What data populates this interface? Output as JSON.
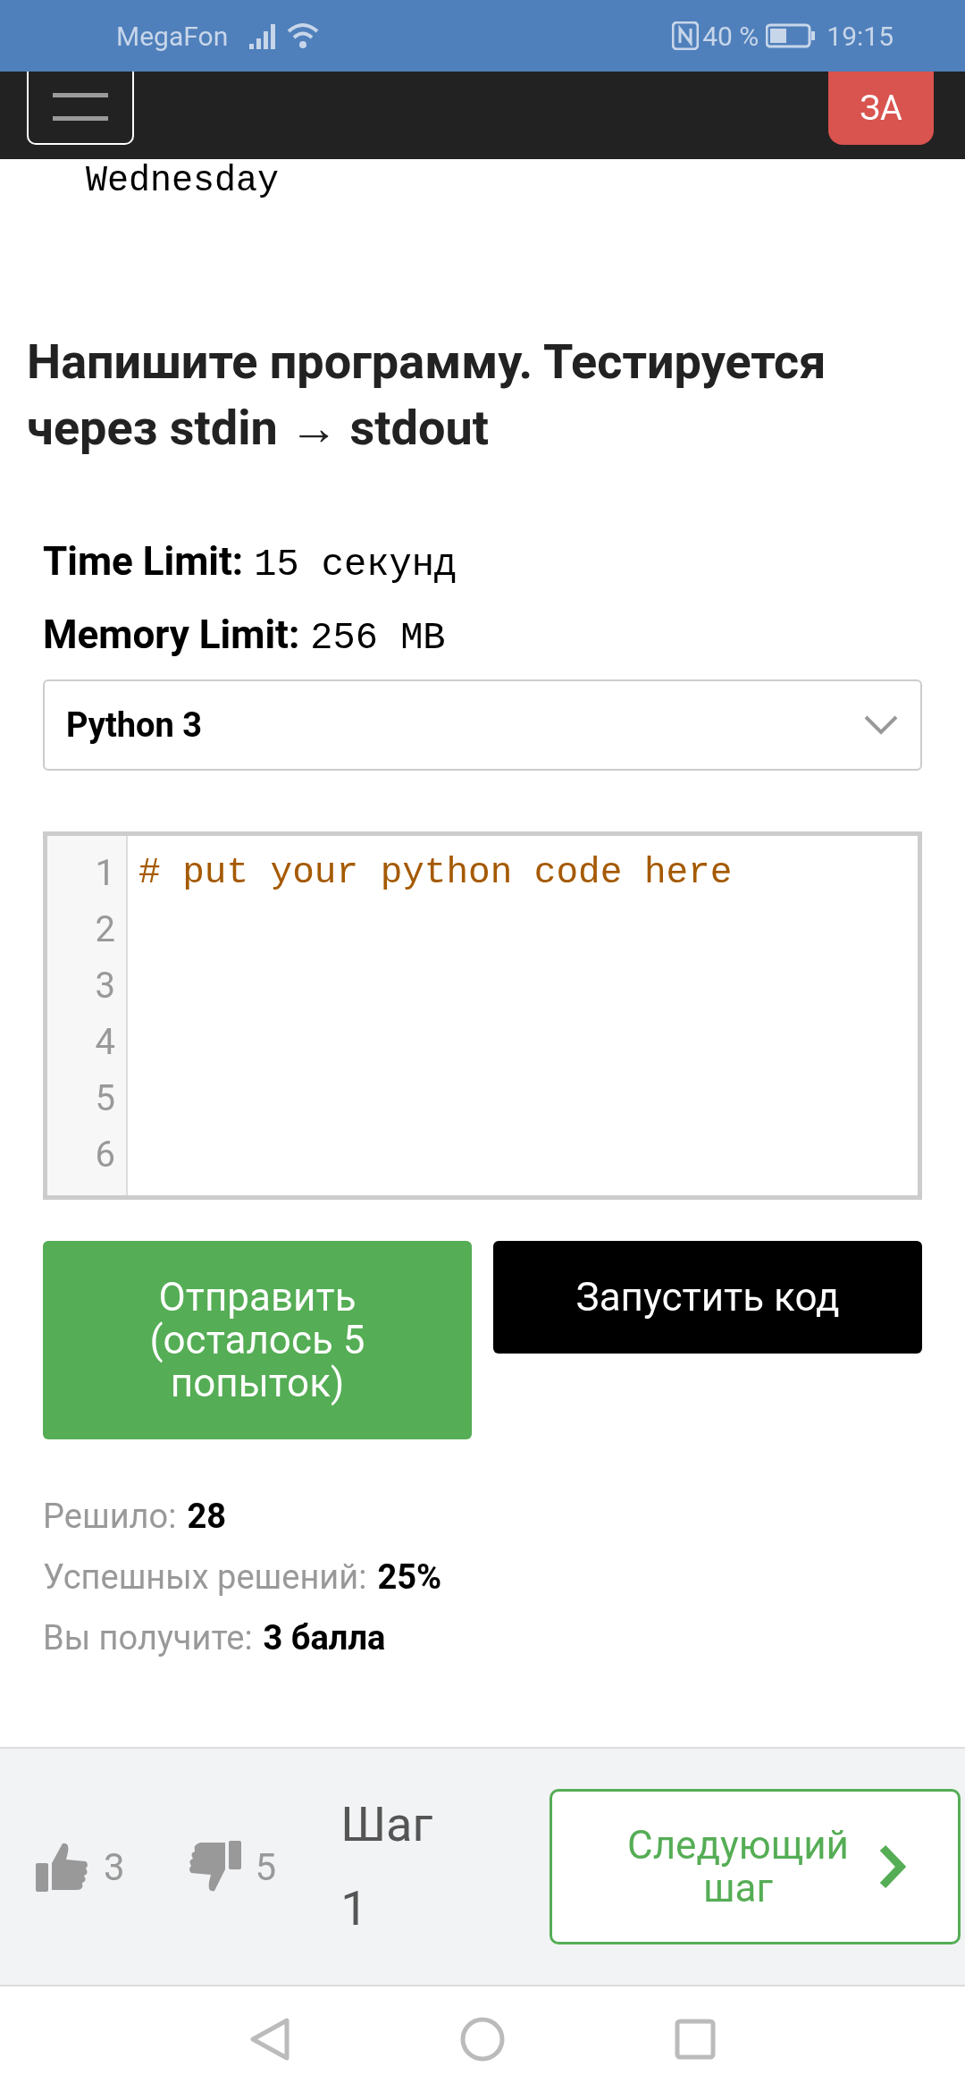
{
  "status_bar": {
    "carrier": "MegaFon",
    "battery": "40 %",
    "time": "19:15"
  },
  "navbar": {
    "action_label": "ЗА"
  },
  "previous_text": "Wednesday",
  "task": {
    "title": "Напишите программу. Тестируется через stdin → stdout",
    "limits": [
      {
        "label": "Time Limit:",
        "value": "15 секунд"
      },
      {
        "label": "Memory Limit:",
        "value": "256 MB"
      }
    ],
    "language": "Python 3",
    "editor": {
      "line_numbers": [
        "1",
        "2",
        "3",
        "4",
        "5",
        "6"
      ],
      "code": "# put your python code here"
    },
    "buttons": [
      {
        "kind": "submit",
        "label": "Отправить (осталось 5 попыток)"
      },
      {
        "kind": "run",
        "label": "Запустить код"
      }
    ],
    "stats": [
      {
        "label": "Решило:",
        "value": "28"
      },
      {
        "label": "Успешных решений:",
        "value": "25%"
      },
      {
        "label": "Вы получите:",
        "value": "3 балла"
      }
    ]
  },
  "footer": {
    "likes": "3",
    "dislikes": "5",
    "step_label": "Шаг",
    "step_number": "1",
    "next_button": "Следующий шаг"
  }
}
